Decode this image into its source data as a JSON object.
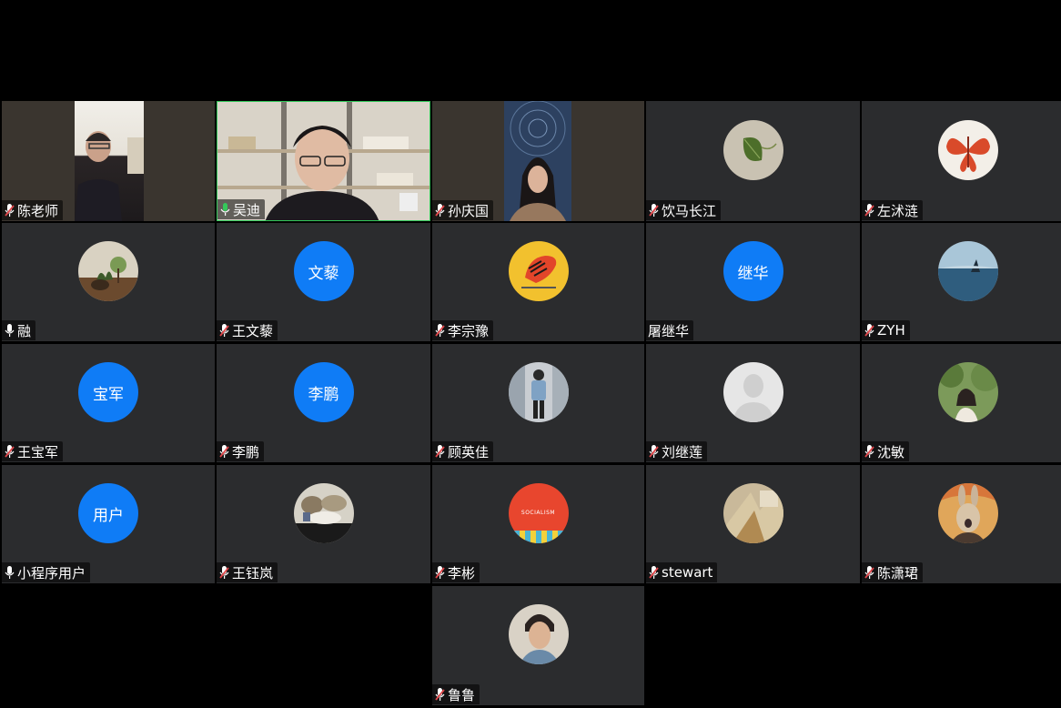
{
  "meeting": {
    "participants": [
      {
        "name": "陈老师",
        "mic": "muted",
        "type": "video",
        "video_theme": "man-office"
      },
      {
        "name": "吴迪",
        "mic": "active",
        "type": "video",
        "video_theme": "man-bookshelf",
        "active_speaker": true
      },
      {
        "name": "孙庆国",
        "mic": "muted",
        "type": "video",
        "video_theme": "woman-starry"
      },
      {
        "name": "饮马长江",
        "mic": "muted",
        "type": "avatar-image",
        "avatar_icon": "leaf-avatar"
      },
      {
        "name": "左沭涟",
        "mic": "muted",
        "type": "avatar-image",
        "avatar_icon": "butterfly-papercut-avatar"
      },
      {
        "name": "融",
        "mic": "on",
        "type": "avatar-image",
        "avatar_icon": "bonsai-avatar"
      },
      {
        "name": "王文藜",
        "mic": "muted",
        "type": "avatar-text",
        "avatar_text": "文藜"
      },
      {
        "name": "李宗豫",
        "mic": "muted",
        "type": "avatar-image",
        "avatar_icon": "tiger-logo-avatar"
      },
      {
        "name": "屠继华",
        "mic": "none",
        "type": "avatar-text",
        "avatar_text": "继华"
      },
      {
        "name": "ZYH",
        "mic": "muted",
        "type": "avatar-image",
        "avatar_icon": "whale-ocean-avatar"
      },
      {
        "name": "王宝军",
        "mic": "muted",
        "type": "avatar-text",
        "avatar_text": "宝军"
      },
      {
        "name": "李鹏",
        "mic": "muted",
        "type": "avatar-text",
        "avatar_text": "李鹏"
      },
      {
        "name": "顾英佳",
        "mic": "muted",
        "type": "avatar-image",
        "avatar_icon": "person-street-avatar"
      },
      {
        "name": "刘继莲",
        "mic": "muted",
        "type": "avatar-image",
        "avatar_icon": "default-user-avatar"
      },
      {
        "name": "沈敏",
        "mic": "muted",
        "type": "avatar-image",
        "avatar_icon": "woman-trees-avatar"
      },
      {
        "name": "小程序用户",
        "mic": "on",
        "type": "avatar-text",
        "avatar_text": "用户"
      },
      {
        "name": "王钰岚",
        "mic": "muted",
        "type": "avatar-image",
        "avatar_icon": "painting-avatar"
      },
      {
        "name": "李彬",
        "mic": "muted",
        "type": "avatar-image",
        "avatar_icon": "socialism-book-avatar",
        "avatar_caption": "SOCIALISM"
      },
      {
        "name": "stewart",
        "mic": "muted",
        "type": "avatar-image",
        "avatar_icon": "abstract-art-avatar"
      },
      {
        "name": "陈潇珺",
        "mic": "muted",
        "type": "avatar-image",
        "avatar_icon": "rabbit-scream-avatar"
      },
      {
        "name": "鲁鲁",
        "mic": "muted",
        "type": "avatar-image",
        "avatar_icon": "young-man-portrait-avatar"
      }
    ]
  },
  "colors": {
    "tile_bg": "#2b2c2e",
    "avatar_blue": "#0f7cf6",
    "active_border": "#34c85a",
    "mic_muted": "#e0464a",
    "mic_active": "#34c85a"
  }
}
